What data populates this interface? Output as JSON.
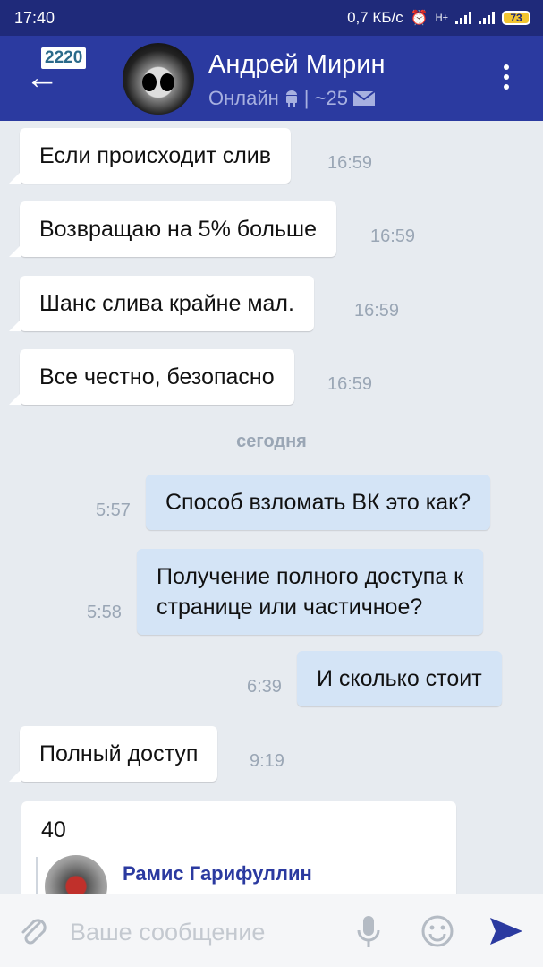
{
  "status_bar": {
    "time": "17:40",
    "speed": "0,7 КБ/с",
    "network": "H+",
    "battery": "73"
  },
  "header": {
    "back_badge": "2220",
    "name": "Андрей Мирин",
    "status": "Онлайн",
    "status_extra": "| ~25",
    "colors": {
      "bar": "#2b3aa0",
      "status_bar": "#1f2a7a"
    }
  },
  "messages": [
    {
      "direction": "in",
      "text": "Если происходит слив",
      "time": "16:59"
    },
    {
      "direction": "in",
      "text": "Возвращаю на 5% больше",
      "time": "16:59"
    },
    {
      "direction": "in",
      "text": "Шанс слива крайне мал.",
      "time": "16:59"
    },
    {
      "direction": "in",
      "text": "Все честно, безопасно",
      "time": "16:59"
    },
    {
      "direction": "out",
      "text": "Способ взломать ВК это как?",
      "time": "5:57"
    },
    {
      "direction": "out",
      "text": "Получение полного доступа к\nстранице или частичное?",
      "time": "5:58"
    },
    {
      "direction": "out",
      "text": "И сколько стоит",
      "time": "6:39"
    },
    {
      "direction": "in",
      "text": "Полный доступ",
      "time": "9:19"
    }
  ],
  "date_separator": "сегодня",
  "forwarded": {
    "text": "40",
    "author": "Рамис Гарифуллин"
  },
  "input": {
    "placeholder": "Ваше сообщение"
  }
}
